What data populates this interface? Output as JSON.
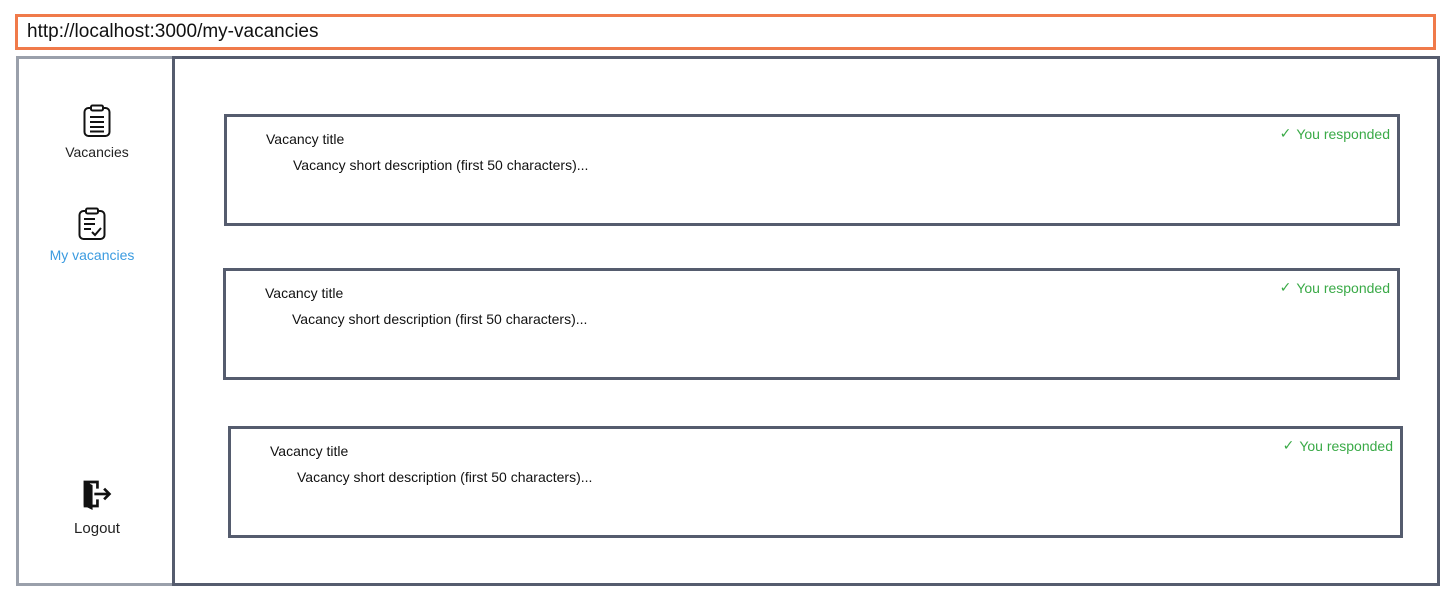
{
  "browser": {
    "url": "http://localhost:3000/my-vacancies"
  },
  "sidebar": {
    "items": [
      {
        "label": "Vacancies",
        "icon": "clipboard-list-icon",
        "active": false
      },
      {
        "label": "My vacancies",
        "icon": "clipboard-check-icon",
        "active": true
      },
      {
        "label": "Logout",
        "icon": "logout-door-icon",
        "active": false
      }
    ],
    "active_color": "#3b9be0"
  },
  "vacancies": [
    {
      "title": "Vacancy title",
      "description": "Vacancy short description (first 50 characters)...",
      "status": "You responded",
      "status_icon": "checkmark-icon"
    },
    {
      "title": "Vacancy title",
      "description": "Vacancy short description (first 50 characters)...",
      "status": "You responded",
      "status_icon": "checkmark-icon"
    },
    {
      "title": "Vacancy title",
      "description": "Vacancy short description (first 50 characters)...",
      "status": "You responded",
      "status_icon": "checkmark-icon"
    }
  ],
  "colors": {
    "url_border": "#f07a4a",
    "frame_border": "#555c6e",
    "sidebar_border": "#9aa0ab",
    "status_green": "#3aaa47"
  }
}
